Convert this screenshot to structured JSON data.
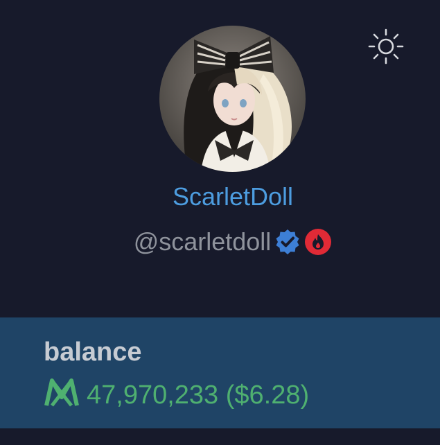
{
  "profile": {
    "display_name": "ScarletDoll",
    "handle": "@scarletdoll",
    "avatar": "avatar-illustration",
    "badges": [
      "verified-badge-icon",
      "flame-badge-icon"
    ]
  },
  "header": {
    "settings_icon": "sun-icon"
  },
  "balance": {
    "label": "balance",
    "currency_icon": "mana-currency-icon",
    "amount": "47,970,233 ($6.28)"
  },
  "colors": {
    "background": "#171a2b",
    "name": "#4d9de0",
    "handle": "#8f939c",
    "panel": "#1f4466",
    "balance_green": "#4fb070",
    "verified": "#3d7fd6",
    "flame": "#e02a36"
  }
}
